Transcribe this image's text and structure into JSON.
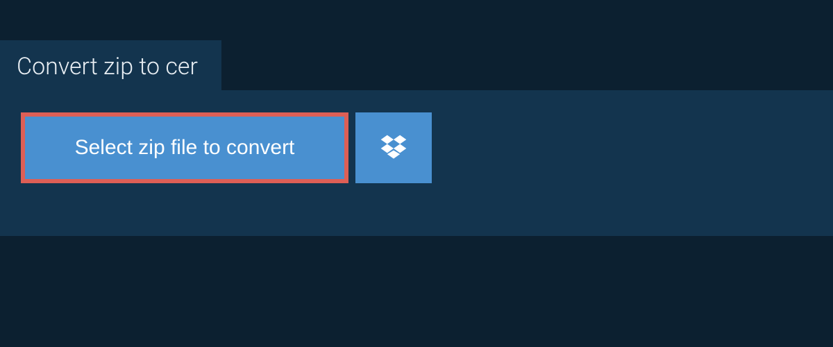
{
  "tab": {
    "title": "Convert zip to cer"
  },
  "panel": {
    "select_label": "Select zip file to convert",
    "dropbox_icon": "dropbox-icon"
  },
  "colors": {
    "background": "#0c2030",
    "panel": "#13344e",
    "button": "#4990d0",
    "highlight_border": "#dd5f56",
    "text_light": "#e8eef3",
    "text_white": "#ffffff"
  }
}
